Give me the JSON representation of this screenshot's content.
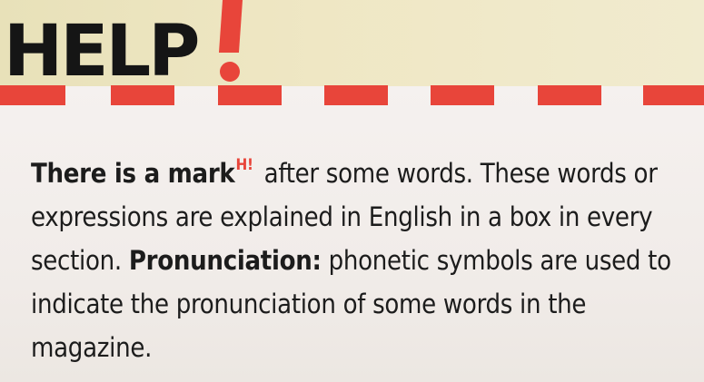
{
  "header": {
    "title": "HELP",
    "exclamation": "!"
  },
  "body": {
    "lead_bold": "There is a mark",
    "mark_symbol": "H!",
    "lead_rest": " after some words. These words or expressions are explained in English in a box in every section.",
    "pronunciation_label": "Pronunciation:",
    "pronunciation_text": " phonetic symbols are used to indicate the pronunciation of some words in the magazine."
  },
  "colors": {
    "accent_red": "#e8453a",
    "header_band": "#efe7c4",
    "panel": "#f3eeea",
    "text": "#1c1c1c"
  }
}
